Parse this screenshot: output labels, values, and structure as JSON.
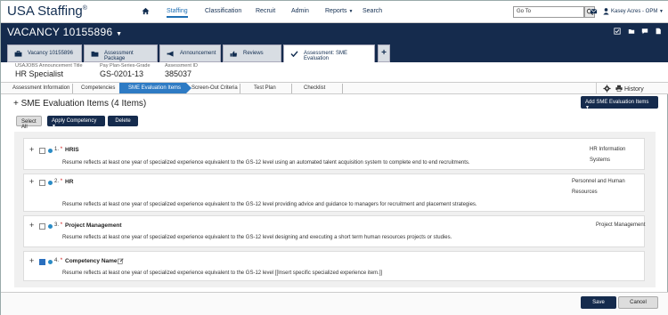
{
  "topnav": {
    "logo": "USA Staffing",
    "logo_mark": "®",
    "items": [
      "Staffing",
      "Classification",
      "Recruit",
      "Admin",
      "Reports",
      "Search"
    ],
    "goto_placeholder": "Go To",
    "user": "Kasey Acres - OPM"
  },
  "header": {
    "vacancy": "VACANCY 10155896",
    "tabs": [
      {
        "label": "Vacancy 10155896",
        "icon": "briefcase-icon"
      },
      {
        "label": "Assessment Package",
        "icon": "folder-icon"
      },
      {
        "label": "Announcement",
        "icon": "megaphone-icon"
      },
      {
        "label": "Reviews",
        "icon": "thumbs-up-icon"
      },
      {
        "label": "Assessment: SME Evaluation",
        "icon": "checkmark-icon"
      }
    ]
  },
  "info": {
    "title_label": "USAJOBS Announcement Title",
    "title_value": "HR Specialist",
    "grade_label": "Pay Plan-Series-Grade",
    "grade_value": "GS-0201-13",
    "id_label": "Assessment ID",
    "id_value": "385037"
  },
  "steps": [
    "Assessment Information",
    "Competencies",
    "SME Evaluation Items",
    "Screen-Out Criteria",
    "Test Plan",
    "Checklist"
  ],
  "history_label": "History",
  "section": {
    "title": "SME Evaluation Items (4 Items)",
    "add_button": "Add SME Evaluation Items",
    "select_all": "Select All",
    "apply_competency": "Apply Competency",
    "delete": "Delete"
  },
  "items": [
    {
      "num": "1.",
      "name": "HRIS",
      "category": "HR Information Systems",
      "desc": "Resume reflects at least one year of specialized experience equivalent to the GS-12 level using an automated talent acquisition system to complete end to end recruitments.",
      "checked": false
    },
    {
      "num": "2.",
      "name": "HR",
      "category": "Personnel and Human Resources",
      "desc": "Resume reflects at least one year of specialized experience equivalent to the GS-12 level providing advice and guidance to managers for recruitment and placement strategies.",
      "checked": false
    },
    {
      "num": "3.",
      "name": "Project Management",
      "category": "Project Management",
      "desc": "Resume reflects at least one year of specialized experience equivalent to the GS-12 level designing and executing a short term human resources projects or studies.",
      "checked": false
    },
    {
      "num": "4.",
      "name": "Competency Name",
      "category": "",
      "desc": "Resume reflects at least one year of specialized experience equivalent to the GS-12 level [[Insert specific specialized experience item.]]",
      "checked": true
    }
  ],
  "footer": {
    "save": "Save",
    "cancel": "Cancel"
  },
  "colors": {
    "navy": "#152b4d",
    "accent": "#2e7bc4",
    "required": "#cc0000"
  }
}
